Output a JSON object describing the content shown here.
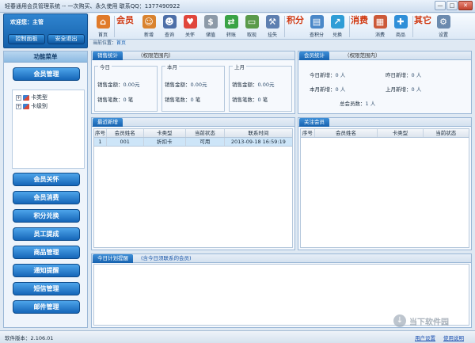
{
  "window": {
    "title": "轻春通用会员管理系统 -- 一次购买、永久使用 联系QQ：1377490922",
    "controls": [
      "—",
      "□",
      "✕"
    ]
  },
  "welcome": {
    "text": "欢迎您：主管",
    "control_panel": "控制面板",
    "safe_exit": "安全退出"
  },
  "toolbar": {
    "home": "首页",
    "member_big": "会员",
    "add": "新增",
    "query": "查询",
    "care": "关怀",
    "deposit": "储值",
    "convert": "转账",
    "withdraw": "取现",
    "loss": "挂失",
    "points_big": "积分",
    "check_points": "查积分",
    "redeem": "兑换",
    "consume_big": "消费",
    "consume": "消费",
    "goods": "商品",
    "other_big": "其它",
    "settings": "设置"
  },
  "breadcrumb": {
    "prefix": "当前位置：",
    "current": "首页"
  },
  "left": {
    "header": "功能菜单",
    "member_mgmt": "会员管理",
    "tree": [
      "卡类型",
      "卡级别"
    ],
    "menu": [
      "会员关怀",
      "会员消费",
      "积分兑换",
      "员工提成",
      "商品管理",
      "通知提醒",
      "短信管理",
      "邮件管理"
    ]
  },
  "sales": {
    "tab": "销售统计",
    "note": "（权限范围内）",
    "groups": [
      {
        "title": "今日",
        "amount_label": "销售金额：",
        "amount": "0.00元",
        "count_label": "销售笔数：",
        "count": "0",
        "unit": "笔"
      },
      {
        "title": "本月",
        "amount_label": "销售金额：",
        "amount": "0.00元",
        "count_label": "销售笔数：",
        "count": "0",
        "unit": "笔"
      },
      {
        "title": "上月",
        "amount_label": "销售金额：",
        "amount": "0.00元",
        "count_label": "销售笔数：",
        "count": "0",
        "unit": "笔"
      }
    ]
  },
  "members": {
    "tab": "会员统计",
    "note": "（权限范围内）",
    "today_label": "今日新增：",
    "today": "0 人",
    "yesterday_label": "昨日新增：",
    "yesterday": "0 人",
    "month_label": "本月新增：",
    "month": "0 人",
    "last_month_label": "上月新增：",
    "last_month": "0 人",
    "total_label": "总会员数：",
    "total": "1 人"
  },
  "recent": {
    "tab": "最近新增",
    "columns": [
      "序号",
      "会员姓名",
      "卡类型",
      "当前状态",
      "联系时间"
    ],
    "rows": [
      {
        "no": "1",
        "name": "001",
        "card": "折扣卡",
        "status": "可用",
        "time": "2013-09-18 16:59:19"
      }
    ]
  },
  "followed": {
    "tab": "关注会员",
    "columns": [
      "序号",
      "会员姓名",
      "卡类型",
      "当前状态"
    ]
  },
  "plan": {
    "tab": "今日计划提醒",
    "note": "(含今日须联系的会员)"
  },
  "status": {
    "version": "软件版本：2.106.01",
    "user_settings": "用户设置",
    "help": "使用说明"
  },
  "watermark": {
    "text": "当下软件园"
  }
}
